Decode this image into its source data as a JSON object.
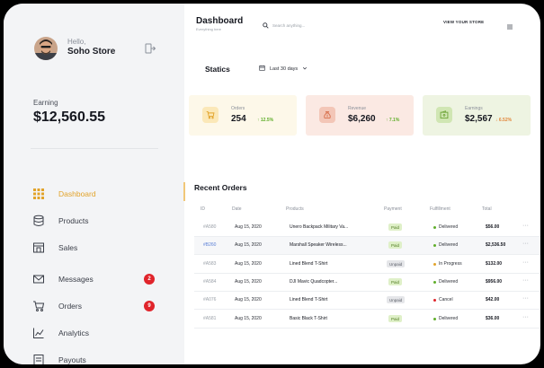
{
  "sidebar": {
    "greeting": "Hello,",
    "store_name": "Soho Store",
    "earning_label": "Earning",
    "earning_value": "$12,560.55",
    "items": [
      {
        "label": "Dashboard",
        "icon": "grid-icon",
        "active": true
      },
      {
        "label": "Products",
        "icon": "database-icon"
      },
      {
        "label": "Sales",
        "icon": "storefront-icon"
      },
      {
        "label": "Messages",
        "icon": "mail-icon",
        "badge": "2"
      },
      {
        "label": "Orders",
        "icon": "cart-icon",
        "badge": "9"
      },
      {
        "label": "Analytics",
        "icon": "chart-line-icon"
      },
      {
        "label": "Payouts",
        "icon": "receipt-icon"
      }
    ]
  },
  "header": {
    "title": "Dashboard",
    "subtitle": "Everything here",
    "search_placeholder": "Search anything...",
    "view_store": "VIEW YOUR STORE"
  },
  "stats": {
    "title": "Statics",
    "range": "Last 30 days",
    "cards": [
      {
        "label": "Orders",
        "value": "254",
        "delta": "↑ 12.5%",
        "delta_color": "#5fae2a",
        "bg": "#fdf8e9",
        "icon_bg": "#fbe8b8",
        "icon_color": "#e2a32a"
      },
      {
        "label": "Revenue",
        "value": "$6,260",
        "delta": "↑ 7.1%",
        "delta_color": "#5fae2a",
        "bg": "#fbe9e3",
        "icon_bg": "#f3c6b7",
        "icon_color": "#d8704c"
      },
      {
        "label": "Earnings",
        "value": "$2,567",
        "delta": "↓ 6.52%",
        "delta_color": "#e2863a",
        "bg": "#eef4e2",
        "icon_bg": "#d0e6b3",
        "icon_color": "#6fa53a"
      }
    ]
  },
  "orders": {
    "title": "Recent Orders",
    "columns": [
      "ID",
      "Date",
      "Products",
      "Payment",
      "Fulfillment",
      "Total"
    ],
    "rows": [
      {
        "id": "#A580",
        "date": "Aug 15, 2020",
        "product": "Unero Backpack Military Va...",
        "payment": "Paid",
        "fulfillment": "Delivered",
        "status_color": "#5fae2a",
        "total": "$56.00"
      },
      {
        "id": "#B260",
        "date": "Aug 15, 2020",
        "product": "Marshall Speaker Wireless...",
        "payment": "Paid",
        "fulfillment": "Delivered",
        "status_color": "#5fae2a",
        "total": "$2,536.50",
        "highlight": true
      },
      {
        "id": "#A583",
        "date": "Aug 15, 2020",
        "product": "Lined Blend T-Shirt",
        "payment": "Unpaid",
        "fulfillment": "In Progress",
        "status_color": "#e2a32a",
        "total": "$132.00"
      },
      {
        "id": "#A584",
        "date": "Aug 15, 2020",
        "product": "DJI Mavic Quadcopter...",
        "payment": "Paid",
        "fulfillment": "Delivered",
        "status_color": "#5fae2a",
        "total": "$956.00"
      },
      {
        "id": "#A076",
        "date": "Aug 15, 2020",
        "product": "Lined Blend T-Shirt",
        "payment": "Unpaid",
        "fulfillment": "Cancel",
        "status_color": "#e0242b",
        "total": "$42.00"
      },
      {
        "id": "#A581",
        "date": "Aug 15, 2020",
        "product": "Basic Black T-Shirt",
        "payment": "Paid",
        "fulfillment": "Delivered",
        "status_color": "#5fae2a",
        "total": "$36.00"
      }
    ],
    "more_label": "···"
  },
  "accent": "#e2a32a"
}
